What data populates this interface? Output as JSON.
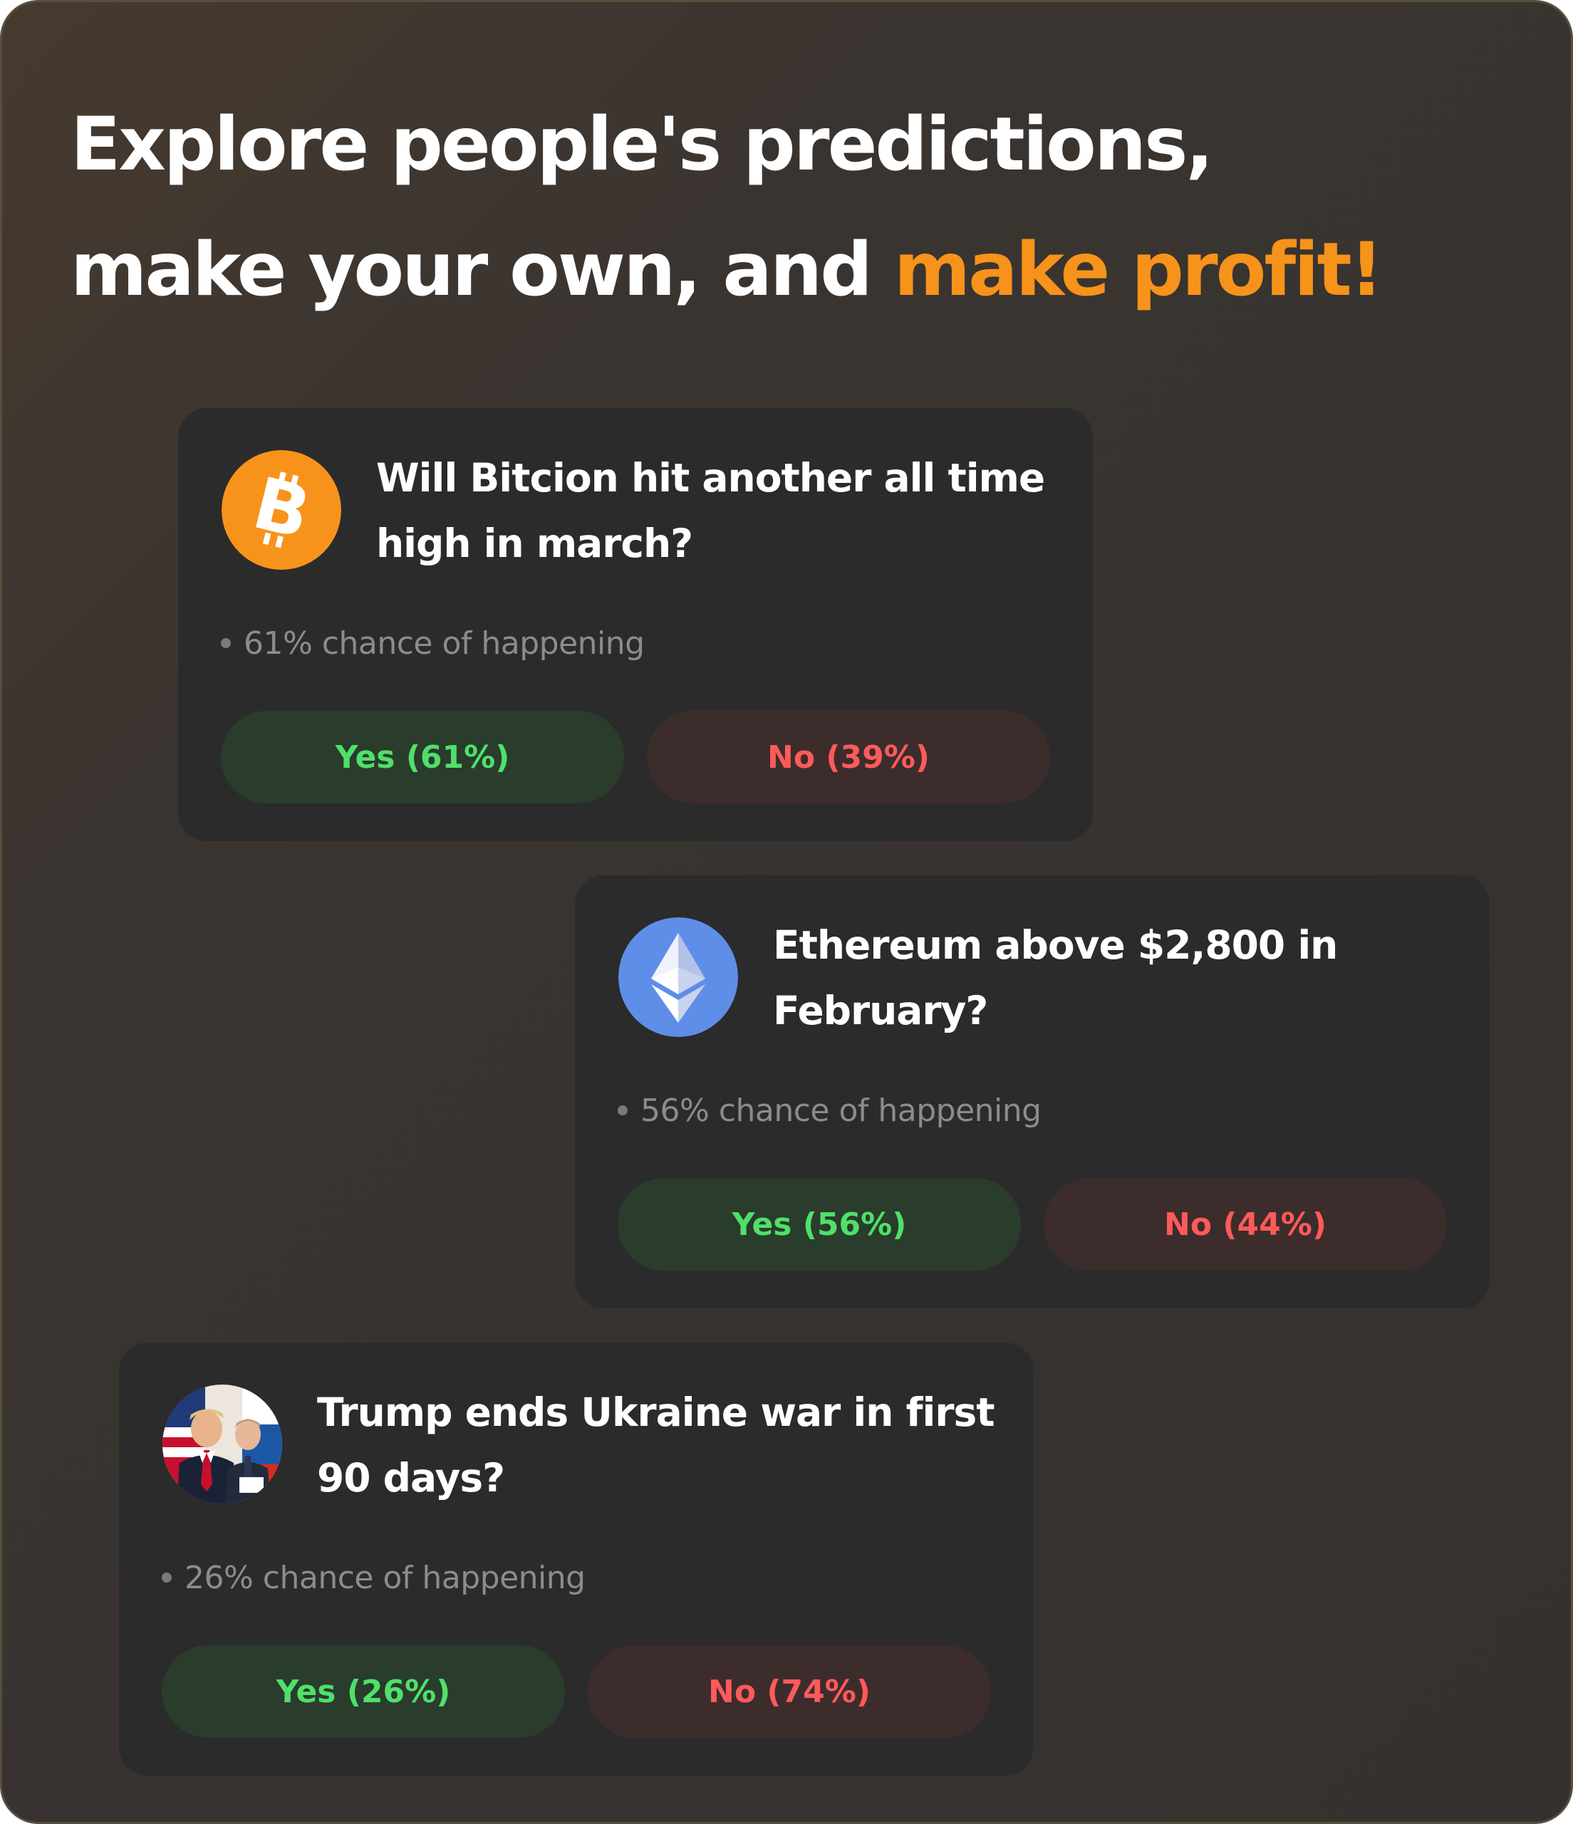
{
  "headline": {
    "line1": "Explore people's predictions,",
    "line2_prefix": "make your own, and ",
    "line2_accent": "make profit!",
    "accent_color": "#f7931a"
  },
  "cards": [
    {
      "icon": "bitcoin-icon",
      "question": "Will Bitcion hit another all time high in march?",
      "chance_text": "61% chance of happening",
      "yes_label": "Yes (61%)",
      "no_label": "No (39%)",
      "probability": 0.61
    },
    {
      "icon": "ethereum-icon",
      "question": "Ethereum above $2,800 in February?",
      "chance_text": "56% chance of happening",
      "yes_label": "Yes (56%)",
      "no_label": "No (44%)",
      "probability": 0.56
    },
    {
      "icon": "trump-putin-photo",
      "question": "Trump ends Ukraine war in first 90 days?",
      "chance_text": "26% chance of happening",
      "yes_label": "Yes (26%)",
      "no_label": "No (74%)",
      "probability": 0.26
    }
  ],
  "colors": {
    "yes_text": "#4fe06a",
    "no_text": "#ff5a5a",
    "bitcoin": "#f7931a",
    "ethereum": "#5f8ee8"
  }
}
